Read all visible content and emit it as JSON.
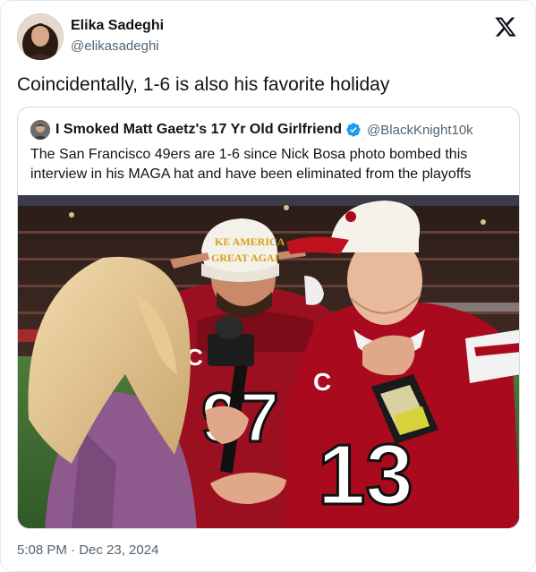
{
  "tweet": {
    "author_name": "Elika Sadeghi",
    "author_handle": "@elikasadeghi",
    "text": "Coincidentally, 1-6 is also his favorite holiday",
    "timestamp": "5:08 PM · Dec 23, 2024"
  },
  "quoted": {
    "author_name": "I Smoked Matt Gaetz's 17 Yr Old Girlfriend",
    "author_handle": "@BlackKnight10k",
    "verified": true,
    "text": "The San Francisco 49ers are 1-6 since Nick Bosa photo bombed this interview in his MAGA hat and have been eliminated from the playoffs"
  },
  "photo": {
    "hat_text_line1": "KE AMERICA",
    "hat_text_line2": "GREAT AGAI",
    "jersey_number_front": "13",
    "jersey_number_back": "97",
    "captain_patch": "C"
  },
  "colors": {
    "text_primary": "#0f1419",
    "text_secondary": "#536471",
    "verified_blue": "#1d9bf0",
    "niners_red": "#aa0a1e"
  },
  "icons": {
    "platform_logo": "x-logo-icon",
    "verified_badge": "verified-badge-icon"
  }
}
